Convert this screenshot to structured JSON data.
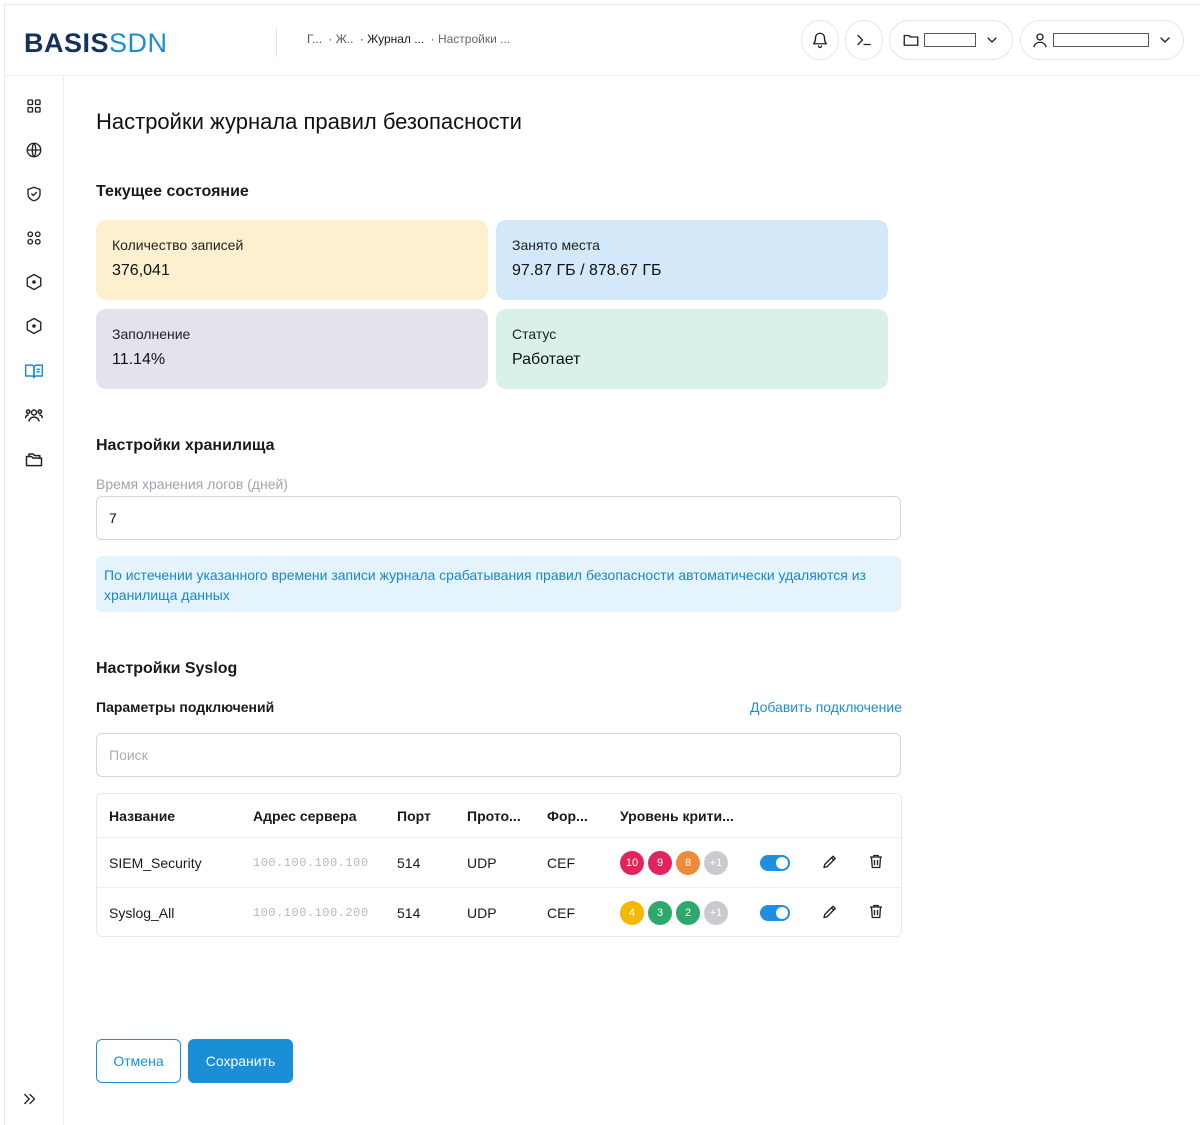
{
  "header": {
    "logo_main": "BASIS",
    "logo_suffix": "SDN",
    "breadcrumbs": [
      "Г...",
      "· Ж..",
      "· Журнал ...",
      "· Настройки ..."
    ]
  },
  "main": {
    "title": "Настройки журнала правил безопасности",
    "current_state": {
      "title": "Текущее состояние",
      "cards": [
        {
          "label": "Количество записей",
          "value": "376,041",
          "color": "#fdf0cf"
        },
        {
          "label": "Занято места",
          "value": "97.87 ГБ / 878.67 ГБ",
          "color": "#d3e9f9"
        },
        {
          "label": "Заполнение",
          "value": "11.14%",
          "color": "#e3e3ee"
        },
        {
          "label": "Статус",
          "value": "Работает",
          "color": "#d9f1e6"
        }
      ]
    },
    "storage": {
      "title": "Настройки хранилища",
      "retention_label": "Время хранения логов (дней)",
      "retention_value": "7",
      "info": "По истечении указанного времени записи журнала срабатывания правил безопасности автоматически удаляются из хранилища данных"
    },
    "syslog": {
      "title": "Настройки Syslog",
      "connections_label": "Параметры подключений",
      "add_link": "Добавить подключение",
      "search_placeholder": "Поиск",
      "columns": [
        "Название",
        "Адрес сервера",
        "Порт",
        "Прото...",
        "Фор...",
        "Уровень крити..."
      ],
      "rows": [
        {
          "name": "SIEM_Security",
          "address": "100.100.100.100",
          "port": "514",
          "protocol": "UDP",
          "format": "CEF",
          "levels": [
            {
              "text": "10",
              "color": "#e0245e"
            },
            {
              "text": "9",
              "color": "#e0245e"
            },
            {
              "text": "8",
              "color": "#ef8a3c"
            },
            {
              "text": "+1",
              "color": "#c9cbcf"
            }
          ],
          "enabled": true
        },
        {
          "name": "Syslog_All",
          "address": "100.100.100.200",
          "port": "514",
          "protocol": "UDP",
          "format": "CEF",
          "levels": [
            {
              "text": "4",
              "color": "#f5b800"
            },
            {
              "text": "3",
              "color": "#2ba86a"
            },
            {
              "text": "2",
              "color": "#2ba86a"
            },
            {
              "text": "+1",
              "color": "#c9cbcf"
            }
          ],
          "enabled": true
        }
      ]
    },
    "buttons": {
      "cancel": "Отмена",
      "save": "Сохранить"
    }
  },
  "colors": {
    "accent": "#1a8fd6",
    "brand_dark": "#16315e"
  }
}
